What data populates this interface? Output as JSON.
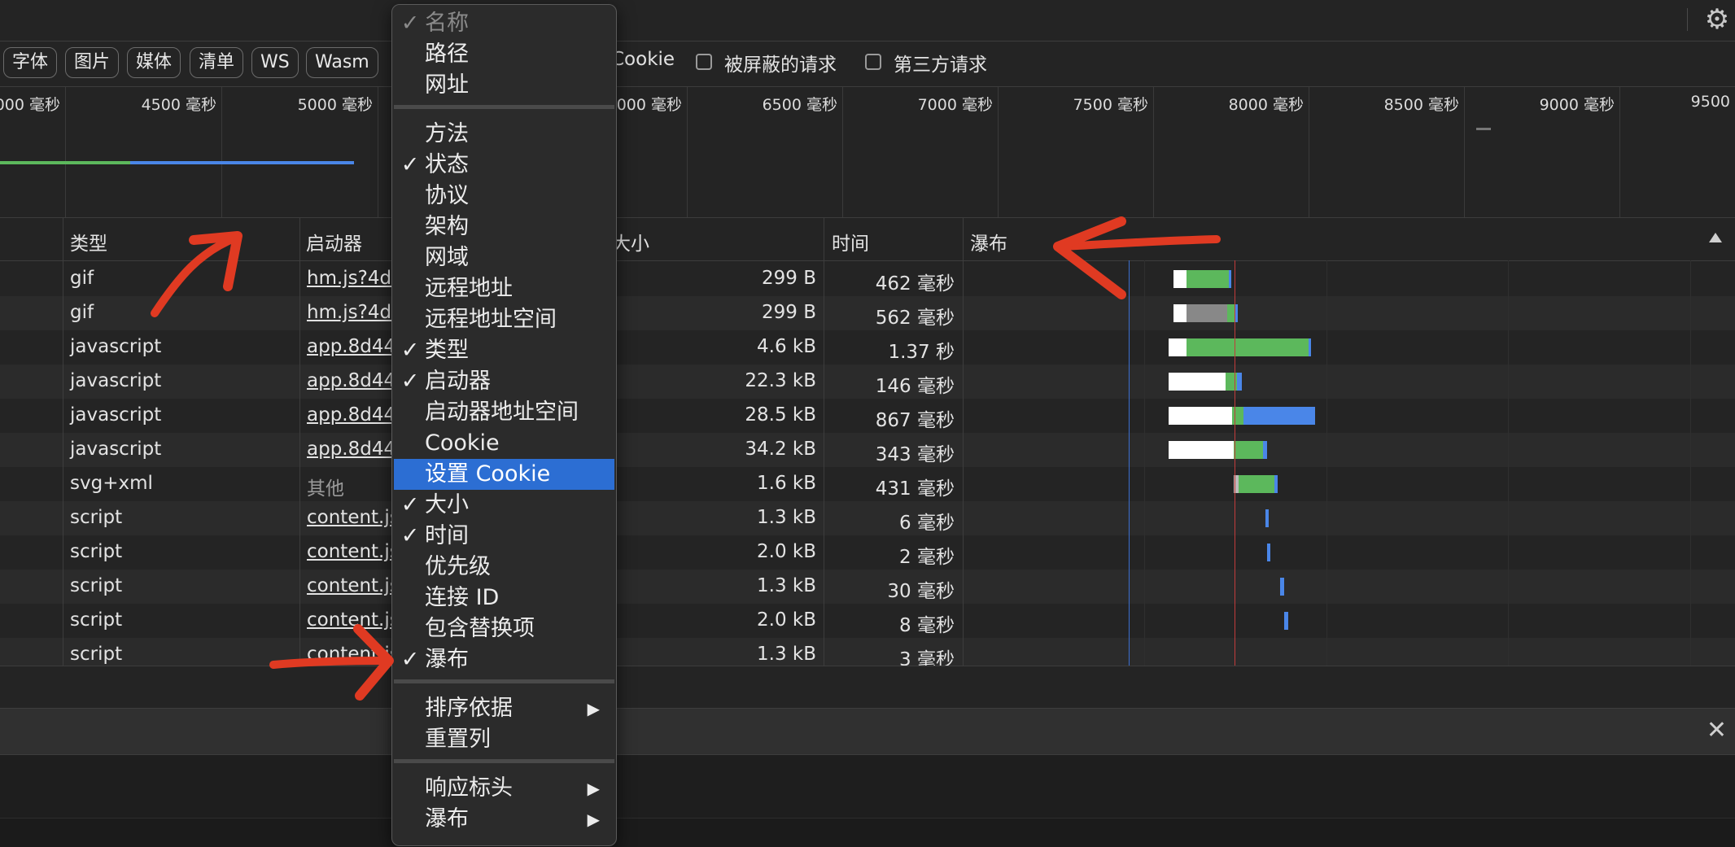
{
  "filter_chips": [
    "字体",
    "图片",
    "媒体",
    "清单",
    "WS",
    "Wasm"
  ],
  "filter_partial": "Cookie",
  "checkboxes": [
    "被屏蔽的请求",
    "第三方请求"
  ],
  "overview_ticks": [
    "000 毫秒",
    "4500 毫秒",
    "5000 毫秒",
    "000 毫秒",
    "6500 毫秒",
    "7000 毫秒",
    "7500 毫秒",
    "8000 毫秒",
    "8500 毫秒",
    "9000 毫秒",
    "9500"
  ],
  "columns": {
    "type": "类型",
    "initiator": "启动器",
    "size": "大小",
    "time": "时间",
    "waterfall": "瀑布",
    "sort_icon": "triangle-up-icon"
  },
  "rows": [
    {
      "type": "gif",
      "initiator": "hm.js?4d",
      "size": "299 B",
      "time": "462 毫秒"
    },
    {
      "type": "gif",
      "initiator": "hm.js?4d",
      "size": "299 B",
      "time": "562 毫秒"
    },
    {
      "type": "javascript",
      "initiator": "app.8d44",
      "size": "4.6 kB",
      "time": "1.37 秒"
    },
    {
      "type": "javascript",
      "initiator": "app.8d44",
      "size": "22.3 kB",
      "time": "146 毫秒"
    },
    {
      "type": "javascript",
      "initiator": "app.8d44",
      "size": "28.5 kB",
      "time": "867 毫秒"
    },
    {
      "type": "javascript",
      "initiator": "app.8d44",
      "size": "34.2 kB",
      "time": "343 毫秒"
    },
    {
      "type": "svg+xml",
      "initiator": "其他",
      "size": "1.6 kB",
      "time": "431 毫秒"
    },
    {
      "type": "script",
      "initiator": "content.js",
      "size": "1.3 kB",
      "time": "6 毫秒"
    },
    {
      "type": "script",
      "initiator": "content.js",
      "size": "2.0 kB",
      "time": "2 毫秒"
    },
    {
      "type": "script",
      "initiator": "content.js",
      "size": "1.3 kB",
      "time": "30 毫秒"
    },
    {
      "type": "script",
      "initiator": "content.js",
      "size": "2.0 kB",
      "time": "8 毫秒"
    },
    {
      "type": "script",
      "initiator": "content.js",
      "size": "1.3 kB",
      "time": "3 毫秒"
    }
  ],
  "context_menu": {
    "items": [
      {
        "label": "名称",
        "checked": true,
        "disabled": true
      },
      {
        "label": "路径",
        "checked": false
      },
      {
        "label": "网址",
        "checked": false
      },
      {
        "separator": true
      },
      {
        "label": "方法",
        "checked": false
      },
      {
        "label": "状态",
        "checked": true
      },
      {
        "label": "协议",
        "checked": false
      },
      {
        "label": "架构",
        "checked": false
      },
      {
        "label": "网域",
        "checked": false
      },
      {
        "label": "远程地址",
        "checked": false
      },
      {
        "label": "远程地址空间",
        "checked": false
      },
      {
        "label": "类型",
        "checked": true
      },
      {
        "label": "启动器",
        "checked": true
      },
      {
        "label": "启动器地址空间",
        "checked": false
      },
      {
        "label": "Cookie",
        "checked": false
      },
      {
        "label": "设置 Cookie",
        "checked": false,
        "highlighted": true
      },
      {
        "label": "大小",
        "checked": true
      },
      {
        "label": "时间",
        "checked": true
      },
      {
        "label": "优先级",
        "checked": false
      },
      {
        "label": "连接 ID",
        "checked": false
      },
      {
        "label": "包含替换项",
        "checked": false
      },
      {
        "label": "瀑布",
        "checked": true
      },
      {
        "separator": true
      },
      {
        "label": "排序依据",
        "submenu": true
      },
      {
        "label": "重置列"
      },
      {
        "separator": true
      },
      {
        "label": "响应标头",
        "submenu": true
      },
      {
        "label": "瀑布",
        "submenu": true
      }
    ]
  },
  "icons": {
    "settings": "gear-icon",
    "close": "close-icon",
    "check": "checkmark-icon",
    "submenu": "triangle-right-icon"
  },
  "colors": {
    "highlight": "#2c6ed3",
    "waterfall_green": "#5cb85c",
    "waterfall_blue": "#4a86e8",
    "annotation_red": "#e03a22"
  }
}
